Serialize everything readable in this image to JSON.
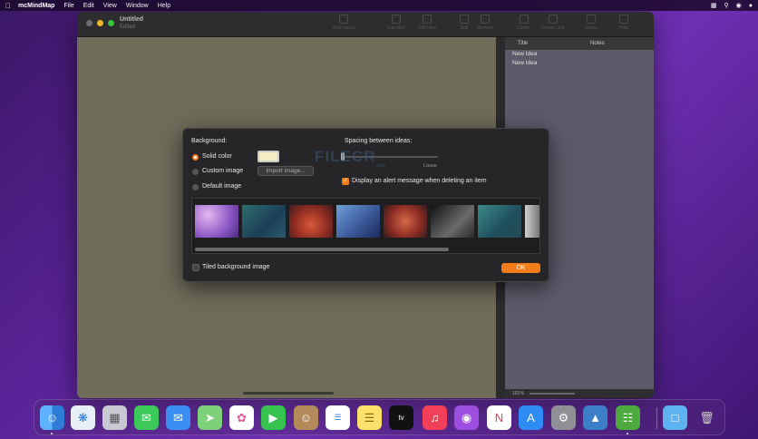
{
  "menubar": {
    "app_name": "mcMindMap",
    "items": [
      "File",
      "Edit",
      "View",
      "Window",
      "Help"
    ]
  },
  "window": {
    "title": "Untitled",
    "subtitle": "Edited",
    "toolbar": [
      "Main Ideas",
      "Sub Idea",
      "Edit Idea",
      "Edit",
      "Remove",
      "Center",
      "Create Link",
      "Styles",
      "Hide"
    ],
    "outline": {
      "col_title": "Title",
      "col_notes": "Notes",
      "items": [
        "New Idea",
        "New Idea"
      ],
      "zoom": "101%"
    }
  },
  "dialog": {
    "background_label": "Background:",
    "solid_color": "Solid color",
    "custom_image": "Custom image",
    "default_image": "Default image",
    "import_button": "Import image...",
    "spacing_label": "Spacing between ideas:",
    "spacing_max_label": "Loose",
    "alert_label": "Display an alert message when deleting an item",
    "alert_checked": true,
    "tiled_label": "Tiled background image",
    "tiled_checked": false,
    "ok_label": "OK",
    "selected_background": "solid",
    "solid_swatch_color": "#f6ecc4",
    "accent_color": "#f57e1a"
  },
  "watermark": {
    "text": "FILECR",
    "sub": ".com"
  },
  "dock": {
    "apps": [
      "finder-icon",
      "safari-icon",
      "launchpad-icon",
      "messages-icon",
      "mail-icon",
      "maps-icon",
      "photos-icon",
      "facetime-icon",
      "contacts-icon",
      "reminders-icon",
      "notes-icon",
      "apple-tv-icon",
      "music-icon",
      "podcasts-icon",
      "news-icon",
      "app-store-icon",
      "system-preferences-icon",
      "altitude-icon",
      "mcmindmap-icon",
      "folder-icon",
      "trash-icon"
    ],
    "tv_label": "tv"
  }
}
